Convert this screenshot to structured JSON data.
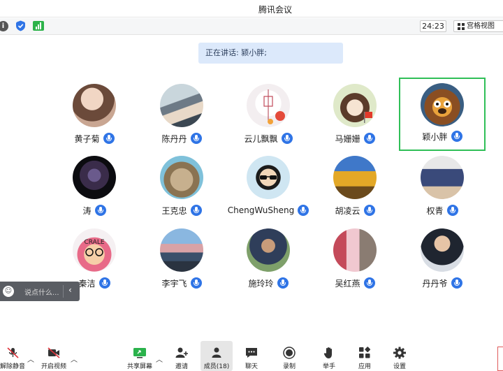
{
  "window": {
    "title": "腾讯会议"
  },
  "topbar": {
    "timer": "24:23",
    "view_label": "宫格视图"
  },
  "speaking": {
    "text": "正在讲话: 颍小胖;"
  },
  "participants": [
    {
      "name": "黄子菊"
    },
    {
      "name": "陈丹丹"
    },
    {
      "name": "云儿飘飘"
    },
    {
      "name": "马姗姗"
    },
    {
      "name": "颖小胖"
    },
    {
      "name": "涛"
    },
    {
      "name": "王克忠"
    },
    {
      "name": "ChengWuSheng"
    },
    {
      "name": "胡凌云"
    },
    {
      "name": "权青"
    },
    {
      "name": "秦洁"
    },
    {
      "name": "李宇飞"
    },
    {
      "name": "施玲玲"
    },
    {
      "name": "吴红燕"
    },
    {
      "name": "丹丹爷"
    }
  ],
  "avatar_badge_text": "CRALE",
  "chat": {
    "placeholder": "说点什么..."
  },
  "toolbar": {
    "unmute": "解除静音",
    "start_video": "开启视频",
    "share_screen": "共享屏幕",
    "invite": "邀请",
    "members": "成员(18)",
    "chat": "聊天",
    "record": "录制",
    "raise_hand": "举手",
    "apps": "应用",
    "settings": "设置"
  },
  "colors": {
    "accent_blue": "#2f74e6",
    "active_green": "#2fbf57",
    "banner_bg": "#dce9fb",
    "signal_green": "#2db34a"
  }
}
